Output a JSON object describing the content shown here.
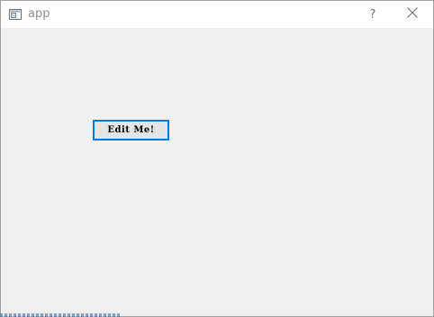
{
  "window": {
    "title": "app",
    "help_glyph": "?",
    "icons": {
      "app": "app-window-icon",
      "close": "close-icon"
    }
  },
  "content": {
    "button_label": "Edit Me!"
  },
  "colors": {
    "focus_border": "#0078d7",
    "background": "#f0f0f0",
    "titlebar": "#ffffff"
  }
}
